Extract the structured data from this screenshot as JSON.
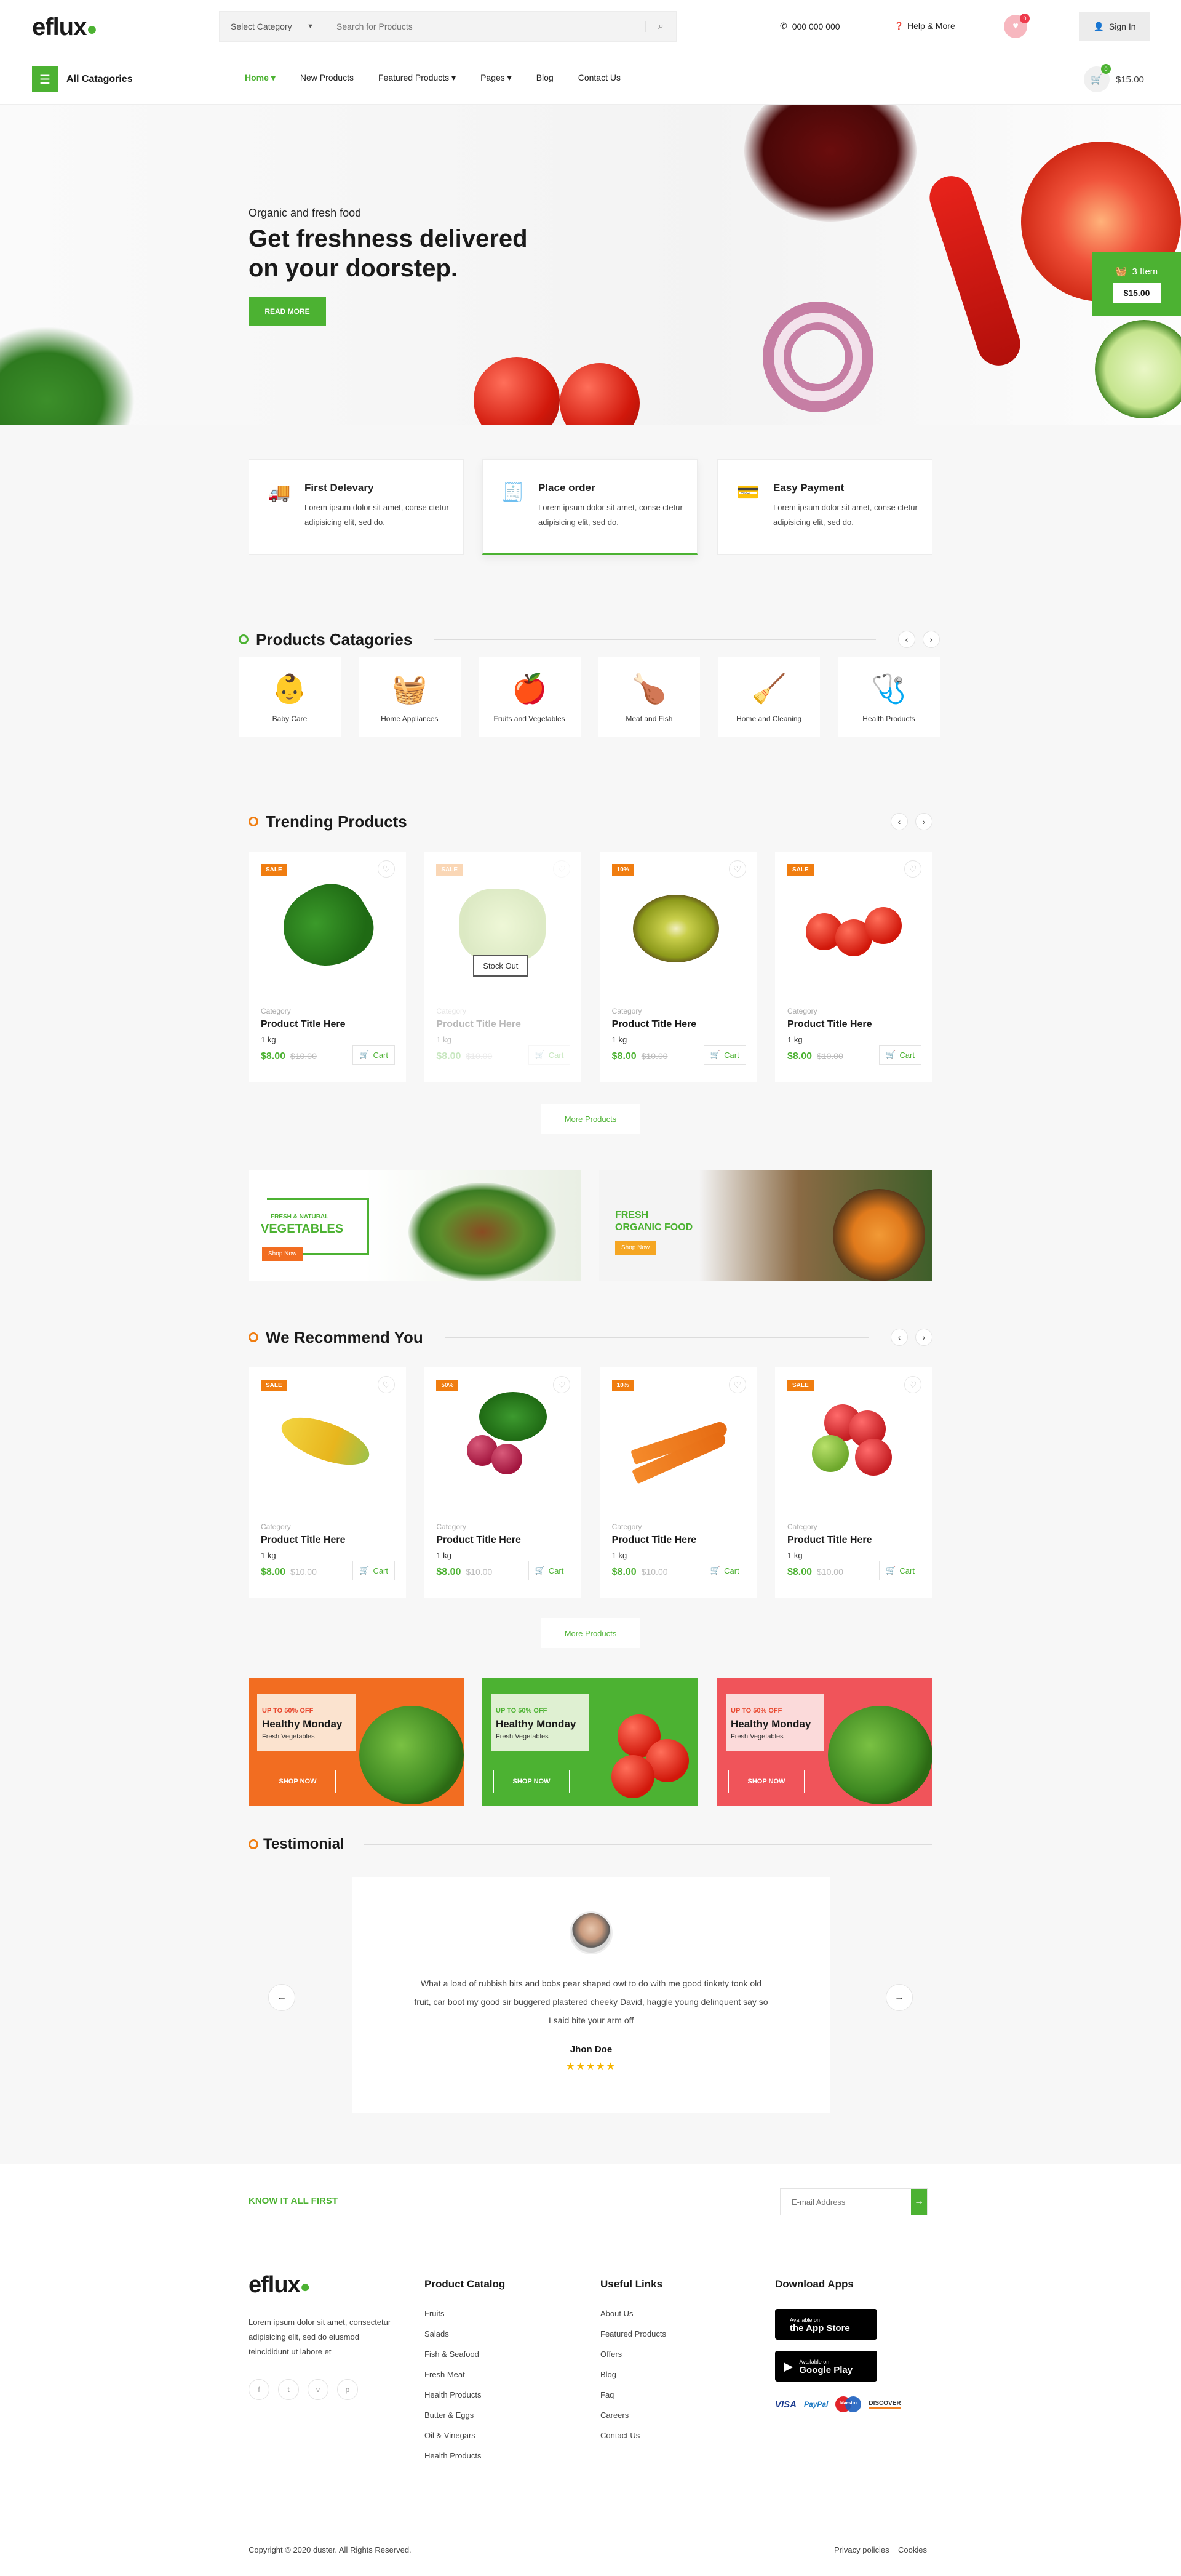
{
  "header": {
    "logo": "eflux",
    "category_select": "Select Category",
    "search_placeholder": "Search for Products",
    "phone": "000 000 000",
    "help": "Help & More",
    "wishlist_count": "0",
    "sign_in": "Sign In"
  },
  "nav": {
    "all_categories": "All Catagories",
    "items": [
      "Home",
      "New Products",
      "Featured Products",
      "Pages",
      "Blog",
      "Contact Us"
    ],
    "cart_count": "0",
    "cart_total": "$15.00"
  },
  "hero": {
    "subtitle": "Organic and fresh food",
    "title_line1": "Get freshness delivered",
    "title_line2": "on your doorstep.",
    "button": "READ MORE",
    "cart_widget_items": "3 Item",
    "cart_widget_total": "$15.00"
  },
  "features": [
    {
      "title": "First Delevary",
      "text": "Lorem ipsum dolor sit amet, conse ctetur adipisicing elit, sed do."
    },
    {
      "title": "Place order",
      "text": "Lorem ipsum dolor sit amet, conse ctetur adipisicing elit, sed do."
    },
    {
      "title": "Easy Payment",
      "text": "Lorem ipsum dolor sit amet, conse ctetur adipisicing elit, sed do."
    }
  ],
  "categories": {
    "title": "Products Catagories",
    "items": [
      "Baby Care",
      "Home Appliances",
      "Fruits and Vegetables",
      "Meat and Fish",
      "Home and Cleaning",
      "Health Products"
    ]
  },
  "trending": {
    "title": "Trending Products",
    "more": "More Products",
    "products": [
      {
        "badge": "SALE",
        "category": "Category",
        "title": "Product Title Here",
        "unit": "1 kg",
        "price": "$8.00",
        "old": "$10.00",
        "cart": "Cart",
        "stock": ""
      },
      {
        "badge": "SALE",
        "category": "Category",
        "title": "Product Title Here",
        "unit": "1 kg",
        "price": "$8.00",
        "old": "$10.00",
        "cart": "Cart",
        "stock": "Stock Out"
      },
      {
        "badge": "10%",
        "category": "Category",
        "title": "Product Title Here",
        "unit": "1 kg",
        "price": "$8.00",
        "old": "$10.00",
        "cart": "Cart",
        "stock": ""
      },
      {
        "badge": "SALE",
        "category": "Category",
        "title": "Product Title Here",
        "unit": "1 kg",
        "price": "$8.00",
        "old": "$10.00",
        "cart": "Cart",
        "stock": ""
      }
    ]
  },
  "banners": [
    {
      "line1": "FRESH & NATURAL",
      "line2": "VEGETABLES",
      "button": "Shop Now"
    },
    {
      "line1": "FRESH",
      "line2": "ORGANIC FOOD",
      "button": "Shop Now"
    }
  ],
  "recommend": {
    "title": "We Recommend You",
    "more": "More Products",
    "products": [
      {
        "badge": "SALE",
        "category": "Category",
        "title": "Product Title Here",
        "unit": "1 kg",
        "price": "$8.00",
        "old": "$10.00",
        "cart": "Cart"
      },
      {
        "badge": "50%",
        "category": "Category",
        "title": "Product Title Here",
        "unit": "1 kg",
        "price": "$8.00",
        "old": "$10.00",
        "cart": "Cart"
      },
      {
        "badge": "10%",
        "category": "Category",
        "title": "Product Title Here",
        "unit": "1 kg",
        "price": "$8.00",
        "old": "$10.00",
        "cart": "Cart"
      },
      {
        "badge": "SALE",
        "category": "Category",
        "title": "Product Title Here",
        "unit": "1 kg",
        "price": "$8.00",
        "old": "$10.00",
        "cart": "Cart"
      }
    ]
  },
  "promos": [
    {
      "tag": "UP TO 50% OFF",
      "title": "Healthy Monday",
      "sub": "Fresh Vegetables",
      "button": "SHOP NOW",
      "color": "#f26d21"
    },
    {
      "tag": "UP TO 50% OFF",
      "title": "Healthy Monday",
      "sub": "Fresh Vegetables",
      "button": "SHOP NOW",
      "color": "#4cb232"
    },
    {
      "tag": "UP TO 50% OFF",
      "title": "Healthy Monday",
      "sub": "Fresh Vegetables",
      "button": "SHOP NOW",
      "color": "#f0545a"
    }
  ],
  "testimonial": {
    "title": "Testimonial",
    "quote": "What a load of rubbish bits and bobs pear shaped owt to do with me good tinkety tonk old fruit, car boot my good sir buggered plastered cheeky David, haggle young delinquent say so I said bite your arm off",
    "name": "Jhon Doe",
    "stars": "★★★★★"
  },
  "newsletter": {
    "label": "KNOW IT ALL FIRST",
    "placeholder": "E-mail Address"
  },
  "footer": {
    "logo": "eflux",
    "about": "Lorem ipsum dolor sit amet, consectetur adipisicing elit, sed do eiusmod teincididunt ut labore et",
    "catalog_title": "Product Catalog",
    "catalog": [
      "Fruits",
      "Salads",
      "Fish & Seafood",
      "Fresh Meat",
      "Health Products",
      "Butter & Eggs",
      "Oil & Vinegars",
      "Health Products"
    ],
    "links_title": "Useful Links",
    "links": [
      "About Us",
      "Featured Products",
      "Offers",
      "Blog",
      "Faq",
      "Careers",
      "Contact Us"
    ],
    "apps_title": "Download Apps",
    "app_store_small": "Available on",
    "app_store": "the App Store",
    "play_small": "Available on",
    "play": "Google Play",
    "payments": [
      "VISA",
      "PayPal",
      "Maestro",
      "DISCOVER"
    ],
    "copyright": "Copyright © 2020 duster. All Rights Reserved.",
    "privacy": "Privacy policies",
    "cookies": "Cookies"
  },
  "colors": {
    "accent": "#4cb232",
    "orange": "#f07d10"
  }
}
